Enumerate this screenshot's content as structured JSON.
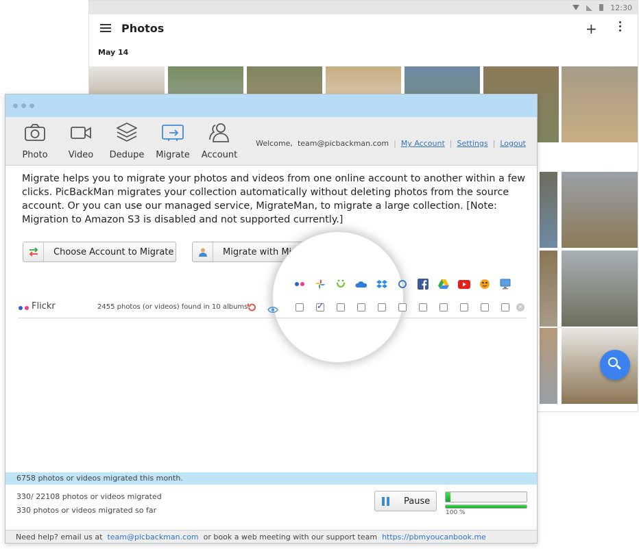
{
  "android": {
    "status_time": "12:30",
    "title": "Photos",
    "date_header": "May 14",
    "photo_colors": [
      "#8a7656",
      "#a7b0b3",
      "#b59a7a",
      "#e9e7e2",
      "#7a8e63",
      "#7f8460",
      "#c8ad82",
      "#6e8aa4",
      "#8c7a58",
      "#a69c88",
      "#6d6e5c",
      "#9aa0a6"
    ],
    "fab_color": "#3b82f0"
  },
  "app": {
    "toolbar": [
      {
        "label": "Photo",
        "icon": "camera-icon"
      },
      {
        "label": "Video",
        "icon": "video-camera-icon"
      },
      {
        "label": "Dedupe",
        "icon": "layers-icon"
      },
      {
        "label": "Migrate",
        "icon": "migrate-icon"
      },
      {
        "label": "Account",
        "icon": "users-icon"
      }
    ],
    "active_tool": "Migrate",
    "welcome": {
      "prefix": "Welcome,",
      "email": "team@picbackman.com",
      "my_account": "My Account",
      "settings": "Settings",
      "logout": "Logout"
    },
    "intro": "Migrate helps you to migrate your photos and videos from one online account to another within a few clicks. PicBackMan migrates your collection automatically without deleting photos from the source account. Or you can use our managed service, MigrateMan, to migrate a large collection. [Note: Migration to Amazon S3 is disabled and not supported currently.]",
    "buttons": {
      "choose": "Choose Account to Migrate",
      "migrateman": "Migrate with MigrateMan"
    },
    "services": [
      {
        "icon": "flickr-icon"
      },
      {
        "icon": "google-photos-icon"
      },
      {
        "icon": "smugmug-icon"
      },
      {
        "icon": "onedrive-icon"
      },
      {
        "icon": "dropbox-icon"
      },
      {
        "icon": "zenfolio-icon"
      },
      {
        "icon": "facebook-icon"
      },
      {
        "icon": "google-drive-icon"
      },
      {
        "icon": "youtube-icon"
      },
      {
        "icon": "imgur-icon"
      },
      {
        "icon": "computer-icon"
      }
    ],
    "account_row": {
      "name": "Flickr",
      "info": "2455 photos (or videos) found in 10 albums",
      "checked": [
        false,
        true,
        false,
        false,
        false,
        false,
        false,
        false,
        false,
        false,
        false
      ]
    },
    "monthly": "6758 photos or videos migrated this month.",
    "progress": {
      "count": "330/ 22108 photos or videos migrated",
      "so_far": "330 photos or videos migrated so far",
      "pause_label": "Pause",
      "bar1_fraction": 0.06,
      "bar2_fraction": 1.0,
      "percent_label": "100 %"
    },
    "help": {
      "prefix": "Need help? email us at",
      "email": "team@picbackman.com",
      "middle": "or book a web meeting with our support team",
      "url": "https://pbmyoucanbook.me"
    },
    "colors": {
      "titlebar": "#b8dbf6",
      "accent": "#3e8ad6",
      "link": "#2d73c6",
      "progress_green": "#17a62a"
    }
  }
}
